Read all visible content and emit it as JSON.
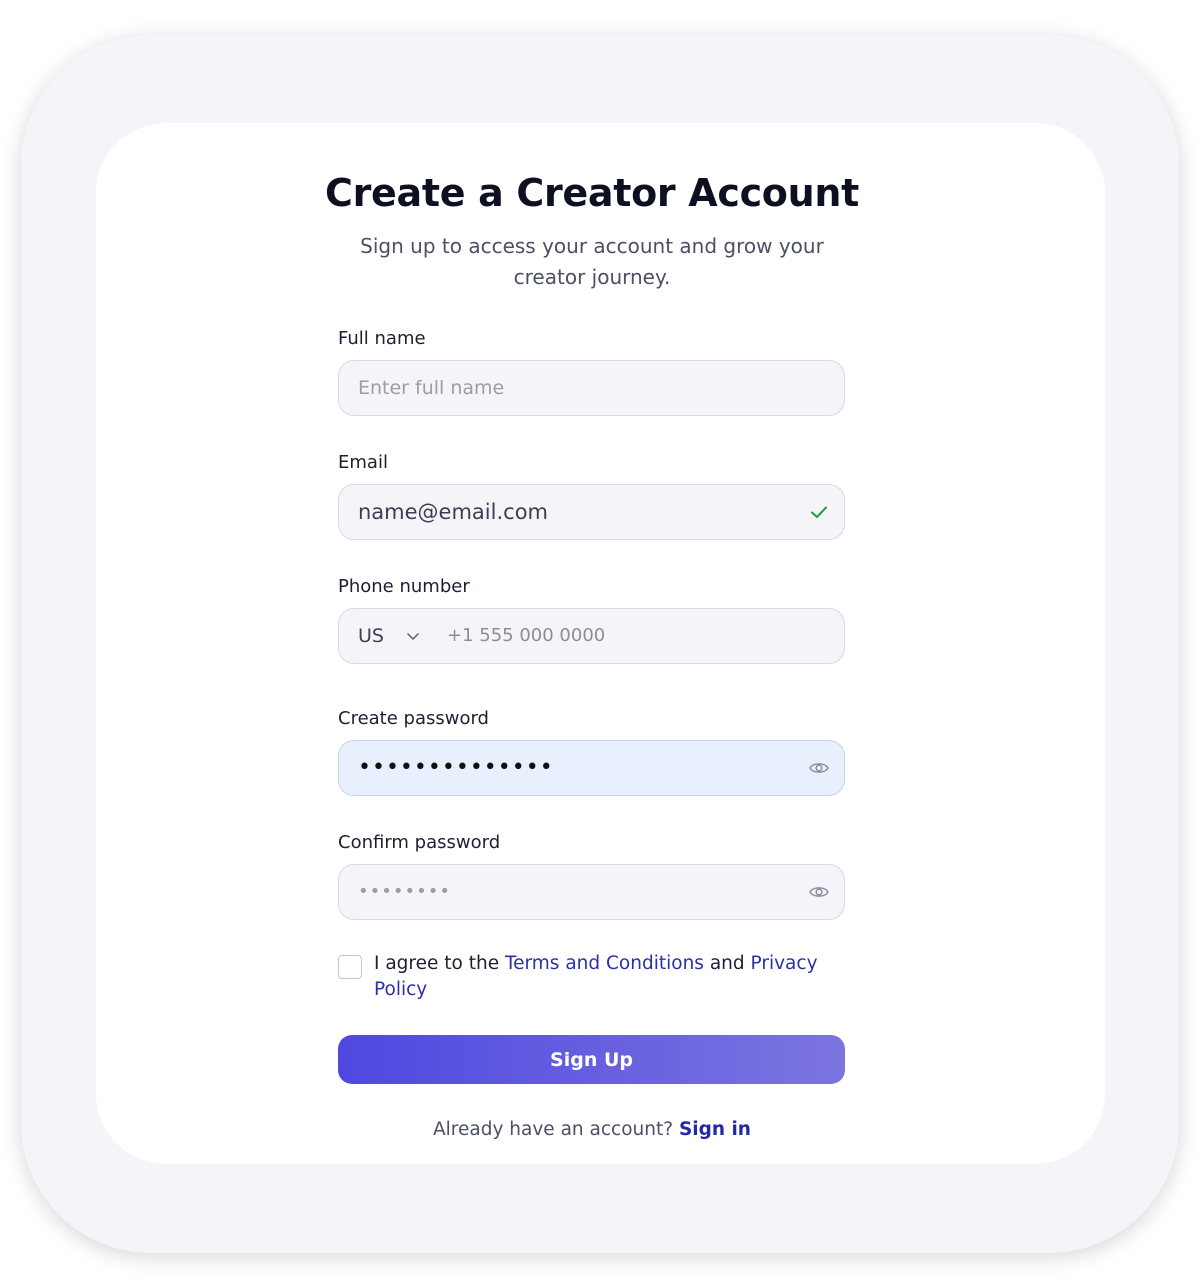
{
  "header": {
    "title": "Create a Creator Account",
    "subtitle": "Sign up to access your account and grow your creator journey."
  },
  "fields": {
    "full_name": {
      "label": "Full name",
      "placeholder": "Enter full name",
      "value": ""
    },
    "email": {
      "label": "Email",
      "value": "name@email.com",
      "status_icon": "check-icon",
      "status_color": "#1e9e4a"
    },
    "phone": {
      "label": "Phone number",
      "country_code": "US",
      "placeholder": "+1 555 000 0000"
    },
    "create_password": {
      "label": "Create password",
      "masked_value": "••••••••••••••",
      "toggle_icon": "eye-icon"
    },
    "confirm_password": {
      "label": "Confirm password",
      "masked_value": "••••••••",
      "toggle_icon": "eye-icon"
    }
  },
  "agreement": {
    "checked": false,
    "prefix": "I agree to the",
    "terms_link": "Terms and Conditions",
    "conjunction": "and",
    "privacy_link": "Privacy Policy"
  },
  "actions": {
    "signup_label": "Sign Up"
  },
  "footer": {
    "prompt": "Already have an account?",
    "signin_link": "Sign in"
  },
  "colors": {
    "accent": "#4e48e1",
    "link": "#2b2fa8",
    "focused_field": "#e8effd"
  }
}
